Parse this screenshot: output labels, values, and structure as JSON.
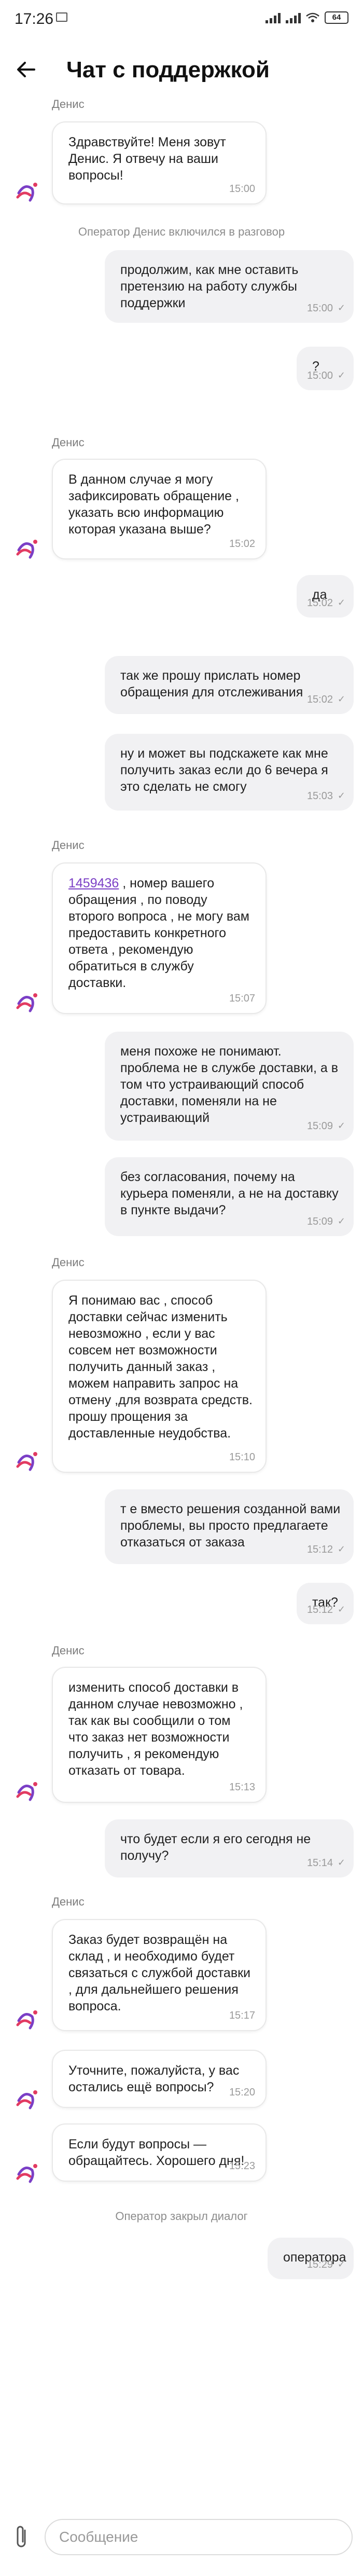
{
  "status_bar": {
    "time": "17:26",
    "battery": "64"
  },
  "header": {
    "title": "Чат с поддержкой"
  },
  "messages": [
    {
      "kind": "sender",
      "text": "Денис"
    },
    {
      "kind": "in",
      "text": "Здравствуйте! Меня зовут Денис. Я отвечу на ваши вопросы!",
      "time": "15:00"
    },
    {
      "kind": "system",
      "text": "Оператор Денис включился в разговор"
    },
    {
      "kind": "out",
      "text": "продолжим, как мне оставить претензию на работу службы поддержки",
      "time": "15:00"
    },
    {
      "kind": "out",
      "text": "?",
      "time": "15:00"
    },
    {
      "kind": "sender",
      "text": "Денис"
    },
    {
      "kind": "in",
      "text": " В данном случае я могу зафиксировать обращение , указать всю информацию которая указана выше?",
      "time": "15:02"
    },
    {
      "kind": "out",
      "text": "да",
      "time": "15:02"
    },
    {
      "kind": "out",
      "text": "так же прошу прислать номер обращения для отслеживания",
      "time": "15:02"
    },
    {
      "kind": "out",
      "text": "ну и может вы подскажете как мне получить заказ если до 6 вечера я это сделать не смогу",
      "time": "15:03"
    },
    {
      "kind": "sender",
      "text": "Денис"
    },
    {
      "kind": "in",
      "link": "1459436",
      "text": " , номер вашего обращения , по поводу второго вопроса , не могу вам предоставить конкретного ответа , рекомендую обратиться в службу доставки.",
      "time": "15:07"
    },
    {
      "kind": "out",
      "text": "меня похоже не понимают. проблема не в службе доставки, а в том что устраивающий способ доставки, поменяли на не устраивающий",
      "time": "15:09"
    },
    {
      "kind": "out",
      "text": "без согласования, почему на курьера поменяли, а не на доставку в пункте выдачи?",
      "time": "15:09"
    },
    {
      "kind": "sender",
      "text": "Денис"
    },
    {
      "kind": "in",
      "text": "Я понимаю вас , способ доставки сейчас изменить невозможно , если у вас совсем нет возможности получить данный заказ , можем направить запрос на отмену ,для возврата средств. прошу прощения за доставленные неудобства.",
      "time": "15:10"
    },
    {
      "kind": "out",
      "text": "т е вместо решения созданной вами проблемы, вы просто предлагаете отказаться от заказа",
      "time": "15:12"
    },
    {
      "kind": "out",
      "text": "так?",
      "time": "15:12"
    },
    {
      "kind": "sender",
      "text": "Денис"
    },
    {
      "kind": "in",
      "text": "изменить способ доставки в данном случае невозможно , так как вы сообщили о том что заказ нет возможности получить , я рекомендую отказать от товара.",
      "time": "15:13"
    },
    {
      "kind": "out",
      "text": "что будет если я его сегодня не получу?",
      "time": "15:14"
    },
    {
      "kind": "sender",
      "text": "Денис"
    },
    {
      "kind": "in",
      "text": "Заказ будет возвращён на склад , и необходимо будет связаться с службой доставки , для дальнейшего решения вопроса.",
      "time": "15:17"
    },
    {
      "kind": "in",
      "text": "Уточните, пожалуйста, у вас остались ещё вопросы?",
      "time": "15:20"
    },
    {
      "kind": "in",
      "text": "Если будут вопросы — обращайтесь. Хорошего дня!",
      "time": "15:23"
    },
    {
      "kind": "system",
      "text": "Оператор закрыл диалог"
    },
    {
      "kind": "out",
      "text": "оператора",
      "time": "15:29"
    }
  ],
  "composer": {
    "placeholder": "Сообщение"
  }
}
